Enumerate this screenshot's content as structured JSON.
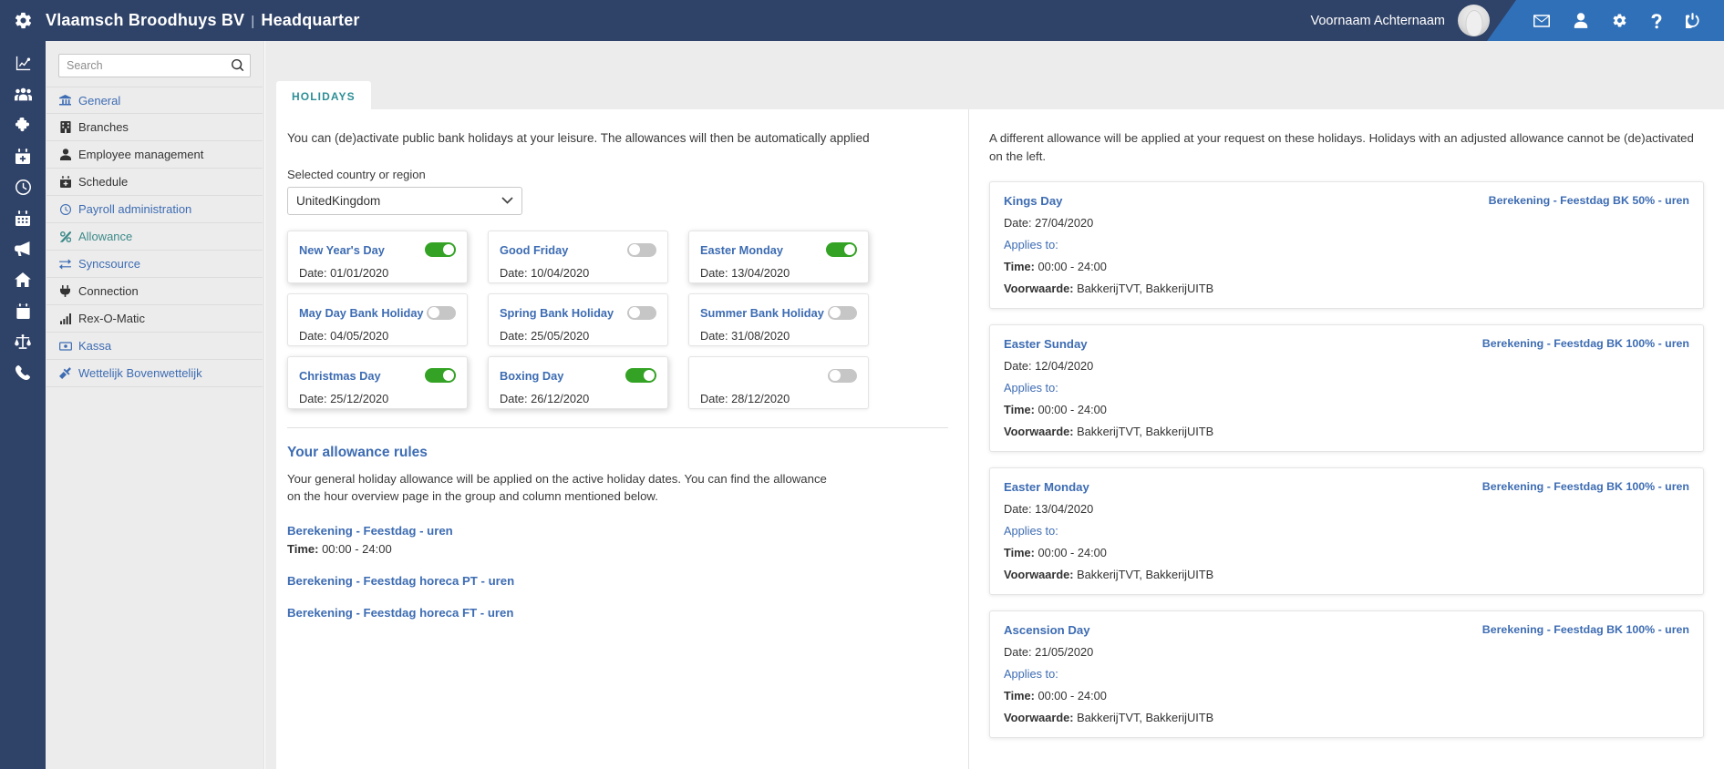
{
  "header": {
    "gear_icon": "gear-icon",
    "company": "Vlaamsch Broodhuys BV",
    "separator": "|",
    "location": "Headquarter",
    "user_name": "Voornaam Achternaam",
    "icons": [
      "mail-icon",
      "user-icon",
      "gear-icon",
      "help-icon",
      "power-icon"
    ]
  },
  "rail": {
    "items": [
      {
        "icon": "analytics-chart-icon"
      },
      {
        "icon": "team-people-icon"
      },
      {
        "icon": "puzzle-plugin-icon"
      },
      {
        "icon": "calendar-add-icon"
      },
      {
        "icon": "clock-icon"
      },
      {
        "icon": "calendar-icon"
      },
      {
        "icon": "megaphone-icon"
      },
      {
        "icon": "home-icon"
      },
      {
        "icon": "clipboard-icon"
      },
      {
        "icon": "scales-balance-icon"
      },
      {
        "icon": "phone-icon"
      }
    ]
  },
  "sidebar": {
    "search_placeholder": "Search",
    "search_value": "",
    "search_icon": "search-icon",
    "items": [
      {
        "label": "General",
        "icon": "bank-icon",
        "style": "blue"
      },
      {
        "label": "Branches",
        "icon": "building-icon",
        "style": "dark"
      },
      {
        "label": "Employee management",
        "icon": "user-icon",
        "style": "dark"
      },
      {
        "label": "Schedule",
        "icon": "calendar-add-icon",
        "style": "dark"
      },
      {
        "label": "Payroll administration",
        "icon": "clock-icon",
        "style": "blue"
      },
      {
        "label": "Allowance",
        "icon": "percent-icon",
        "style": "teal"
      },
      {
        "label": "Syncsource",
        "icon": "sync-arrows-icon",
        "style": "blue"
      },
      {
        "label": "Connection",
        "icon": "plug-icon",
        "style": "dark"
      },
      {
        "label": "Rex-O-Matic",
        "icon": "signal-bars-icon",
        "style": "dark"
      },
      {
        "label": "Kassa",
        "icon": "banknote-icon",
        "style": "blue"
      },
      {
        "label": "Wettelijk Bovenwettelijk",
        "icon": "gavel-icon",
        "style": "blue"
      }
    ]
  },
  "main": {
    "tab_label": "HOLIDAYS",
    "intro": "You can (de)activate public bank holidays at your leisure. The allowances will then be automatically applied",
    "country_label": "Selected country or region",
    "country_value": "UnitedKingdom",
    "chevron_icon": "chevron-down-icon",
    "holidays": [
      {
        "name": "New Year's Day",
        "date_label": "Date:",
        "date": "01/01/2020",
        "enabled": true,
        "raised": true
      },
      {
        "name": "Good Friday",
        "date_label": "Date:",
        "date": "10/04/2020",
        "enabled": false,
        "raised": false
      },
      {
        "name": "Easter Monday",
        "date_label": "Date:",
        "date": "13/04/2020",
        "enabled": true,
        "raised": true
      },
      {
        "name": "May Day Bank Holiday",
        "date_label": "Date:",
        "date": "04/05/2020",
        "enabled": false,
        "raised": false
      },
      {
        "name": "Spring Bank Holiday",
        "date_label": "Date:",
        "date": "25/05/2020",
        "enabled": false,
        "raised": false
      },
      {
        "name": "Summer Bank Holiday",
        "date_label": "Date:",
        "date": "31/08/2020",
        "enabled": false,
        "raised": false
      },
      {
        "name": "Christmas Day",
        "date_label": "Date:",
        "date": "25/12/2020",
        "enabled": true,
        "raised": true
      },
      {
        "name": "Boxing Day",
        "date_label": "Date:",
        "date": "26/12/2020",
        "enabled": true,
        "raised": true
      },
      {
        "name": "",
        "date_label": "Date:",
        "date": "28/12/2020",
        "enabled": false,
        "raised": false
      }
    ],
    "rules_title": "Your allowance rules",
    "rules_body": "Your general holiday allowance will be applied on the active holiday dates. You can find the allowance on the hour overview page in the group and column mentioned below.",
    "rules": [
      {
        "link": "Berekening - Feestdag - uren",
        "time_label": "Time:",
        "time": "00:00 - 24:00"
      },
      {
        "link": "Berekening - Feestdag horeca PT - uren",
        "time_label": "",
        "time": ""
      },
      {
        "link": "Berekening - Feestdag horeca FT - uren",
        "time_label": "",
        "time": ""
      }
    ]
  },
  "right": {
    "intro": "A different allowance will be applied at your request on these holidays. Holidays with an adjusted allowance cannot be (de)activated on the left.",
    "cards": [
      {
        "title": "Kings Day",
        "calc": "Berekening - Feestdag BK 50% - uren",
        "date_label": "Date:",
        "date": "27/04/2020",
        "applies_label": "Applies to:",
        "time_label": "Time:",
        "time": "00:00 - 24:00",
        "cond_label": "Voorwaarde:",
        "cond": "BakkerijTVT, BakkerijUITB"
      },
      {
        "title": "Easter Sunday",
        "calc": "Berekening - Feestdag BK 100% - uren",
        "date_label": "Date:",
        "date": "12/04/2020",
        "applies_label": "Applies to:",
        "time_label": "Time:",
        "time": "00:00 - 24:00",
        "cond_label": "Voorwaarde:",
        "cond": "BakkerijTVT, BakkerijUITB"
      },
      {
        "title": "Easter Monday",
        "calc": "Berekening - Feestdag BK 100% - uren",
        "date_label": "Date:",
        "date": "13/04/2020",
        "applies_label": "Applies to:",
        "time_label": "Time:",
        "time": "00:00 - 24:00",
        "cond_label": "Voorwaarde:",
        "cond": "BakkerijTVT, BakkerijUITB"
      },
      {
        "title": "Ascension Day",
        "calc": "Berekening - Feestdag BK 100% - uren",
        "date_label": "Date:",
        "date": "21/05/2020",
        "applies_label": "Applies to:",
        "time_label": "Time:",
        "time": "00:00 - 24:00",
        "cond_label": "Voorwaarde:",
        "cond": "BakkerijTVT, BakkerijUITB"
      }
    ]
  },
  "colors": {
    "header_bg": "#2f4268",
    "header_accent": "#3070b8",
    "link_blue": "#3d6cb3",
    "tab_teal": "#2d8f97",
    "toggle_on": "#34a325",
    "toggle_off": "#c6c6c6",
    "page_bg": "#ececec"
  }
}
